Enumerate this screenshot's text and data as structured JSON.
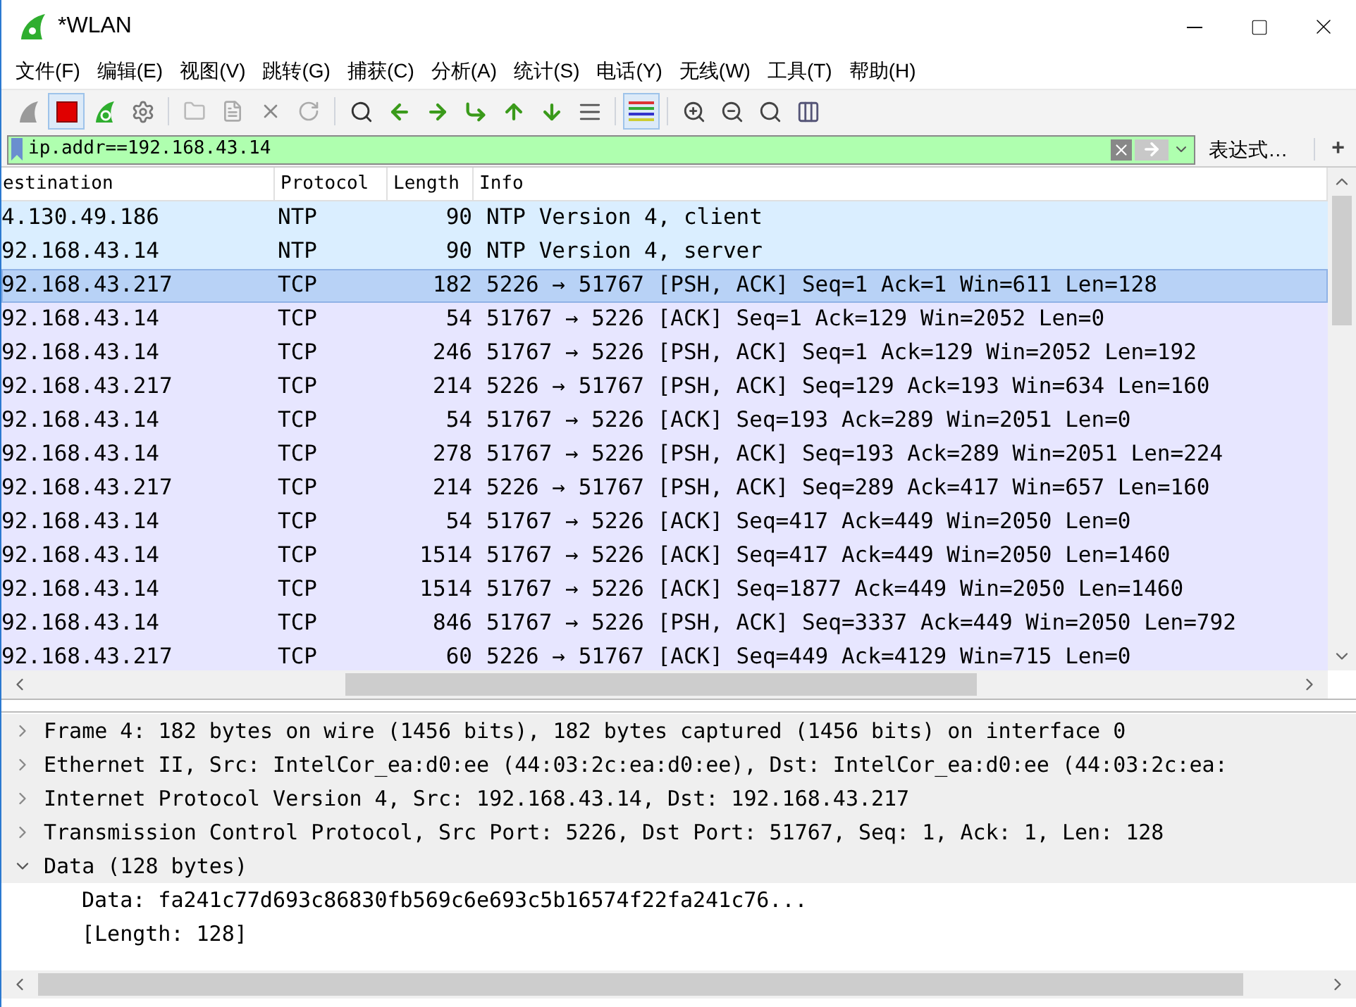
{
  "window": {
    "title": "*WLAN"
  },
  "menu": [
    "文件(F)",
    "编辑(E)",
    "视图(V)",
    "跳转(G)",
    "捕获(C)",
    "分析(A)",
    "统计(S)",
    "电话(Y)",
    "无线(W)",
    "工具(T)",
    "帮助(H)"
  ],
  "toolbar": [
    {
      "kind": "fin",
      "pressed": false
    },
    {
      "kind": "stop",
      "pressed": true
    },
    {
      "kind": "restart",
      "pressed": false
    },
    {
      "kind": "options",
      "pressed": false
    },
    {
      "kind": "sep"
    },
    {
      "kind": "open",
      "pressed": false
    },
    {
      "kind": "file",
      "pressed": false
    },
    {
      "kind": "close",
      "pressed": false
    },
    {
      "kind": "reload",
      "pressed": false
    },
    {
      "kind": "sep"
    },
    {
      "kind": "find",
      "pressed": false
    },
    {
      "kind": "back",
      "pressed": false
    },
    {
      "kind": "forward",
      "pressed": false
    },
    {
      "kind": "goto",
      "pressed": false
    },
    {
      "kind": "first",
      "pressed": false
    },
    {
      "kind": "last",
      "pressed": false
    },
    {
      "kind": "autoscroll",
      "pressed": false
    },
    {
      "kind": "sep"
    },
    {
      "kind": "colorize",
      "pressed": true
    },
    {
      "kind": "sep"
    },
    {
      "kind": "zoomin",
      "pressed": false
    },
    {
      "kind": "zoomout",
      "pressed": false
    },
    {
      "kind": "zoomreset",
      "pressed": false
    },
    {
      "kind": "resize",
      "pressed": false
    }
  ],
  "filter": {
    "value": "ip.addr==192.168.43.14",
    "expression_label": "表达式…",
    "add_label": "+"
  },
  "table": {
    "columns": [
      "estination",
      "Protocol",
      "Length",
      "Info"
    ],
    "rows": [
      {
        "destination": "4.130.49.186",
        "protocol": "NTP",
        "length": "90",
        "info": "NTP Version 4, client",
        "color": "#daeeff",
        "selected": false
      },
      {
        "destination": "92.168.43.14",
        "protocol": "NTP",
        "length": "90",
        "info": "NTP Version 4, server",
        "color": "#daeeff",
        "selected": false
      },
      {
        "destination": "92.168.43.217",
        "protocol": "TCP",
        "length": "182",
        "info": "5226 → 51767 [PSH, ACK] Seq=1 Ack=1 Win=611 Len=128",
        "color": "#b8d2f6",
        "selected": true
      },
      {
        "destination": "92.168.43.14",
        "protocol": "TCP",
        "length": "54",
        "info": "51767 → 5226 [ACK] Seq=1 Ack=129 Win=2052 Len=0",
        "color": "#e7e6ff",
        "selected": false
      },
      {
        "destination": "92.168.43.14",
        "protocol": "TCP",
        "length": "246",
        "info": "51767 → 5226 [PSH, ACK] Seq=1 Ack=129 Win=2052 Len=192",
        "color": "#e7e6ff",
        "selected": false
      },
      {
        "destination": "92.168.43.217",
        "protocol": "TCP",
        "length": "214",
        "info": "5226 → 51767 [PSH, ACK] Seq=129 Ack=193 Win=634 Len=160",
        "color": "#e7e6ff",
        "selected": false
      },
      {
        "destination": "92.168.43.14",
        "protocol": "TCP",
        "length": "54",
        "info": "51767 → 5226 [ACK] Seq=193 Ack=289 Win=2051 Len=0",
        "color": "#e7e6ff",
        "selected": false
      },
      {
        "destination": "92.168.43.14",
        "protocol": "TCP",
        "length": "278",
        "info": "51767 → 5226 [PSH, ACK] Seq=193 Ack=289 Win=2051 Len=224",
        "color": "#e7e6ff",
        "selected": false
      },
      {
        "destination": "92.168.43.217",
        "protocol": "TCP",
        "length": "214",
        "info": "5226 → 51767 [PSH, ACK] Seq=289 Ack=417 Win=657 Len=160",
        "color": "#e7e6ff",
        "selected": false
      },
      {
        "destination": "92.168.43.14",
        "protocol": "TCP",
        "length": "54",
        "info": "51767 → 5226 [ACK] Seq=417 Ack=449 Win=2050 Len=0",
        "color": "#e7e6ff",
        "selected": false
      },
      {
        "destination": "92.168.43.14",
        "protocol": "TCP",
        "length": "1514",
        "info": "51767 → 5226 [ACK] Seq=417 Ack=449 Win=2050 Len=1460",
        "color": "#e7e6ff",
        "selected": false
      },
      {
        "destination": "92.168.43.14",
        "protocol": "TCP",
        "length": "1514",
        "info": "51767 → 5226 [ACK] Seq=1877 Ack=449 Win=2050 Len=1460",
        "color": "#e7e6ff",
        "selected": false
      },
      {
        "destination": "92.168.43.14",
        "protocol": "TCP",
        "length": "846",
        "info": "51767 → 5226 [PSH, ACK] Seq=3337 Ack=449 Win=2050 Len=792",
        "color": "#e7e6ff",
        "selected": false
      },
      {
        "destination": "92.168.43.217",
        "protocol": "TCP",
        "length": "60",
        "info": "5226 → 51767 [ACK] Seq=449 Ack=4129 Win=715 Len=0",
        "color": "#e7e6ff",
        "selected": false
      }
    ]
  },
  "details": [
    {
      "text": "Frame 4: 182 bytes on wire (1456 bits), 182 bytes captured (1456 bits) on interface 0",
      "expanded": false
    },
    {
      "text": "Ethernet II, Src: IntelCor_ea:d0:ee (44:03:2c:ea:d0:ee), Dst: IntelCor_ea:d0:ee (44:03:2c:ea:",
      "expanded": false
    },
    {
      "text": "Internet Protocol Version 4, Src: 192.168.43.14, Dst: 192.168.43.217",
      "expanded": false
    },
    {
      "text": "Transmission Control Protocol, Src Port: 5226, Dst Port: 51767, Seq: 1, Ack: 1, Len: 128",
      "expanded": false
    },
    {
      "text": "Data (128 bytes)",
      "expanded": true,
      "children": [
        {
          "text": "Data: fa241c77d693c86830fb569c6e693c5b16574f22fa241c76..."
        },
        {
          "text": "[Length: 128]"
        }
      ]
    }
  ]
}
